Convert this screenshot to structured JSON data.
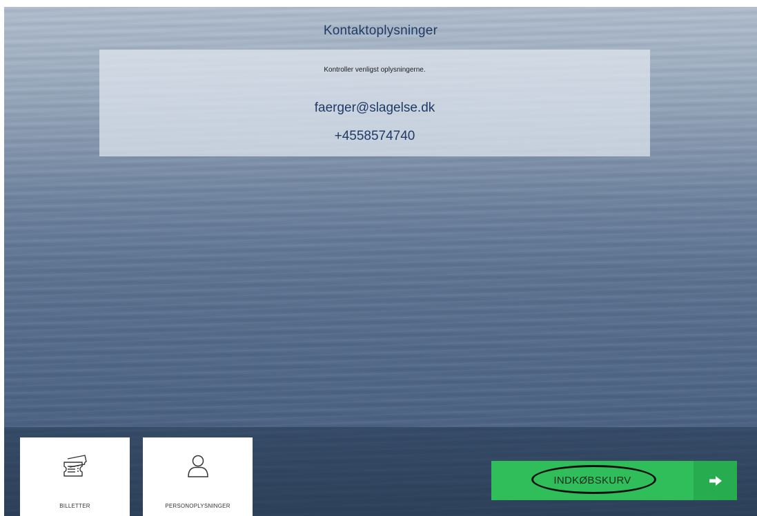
{
  "page": {
    "title": "Kontaktoplysninger"
  },
  "contact": {
    "note": "Kontroller venligst oplysningerne.",
    "email": "faerger@slagelse.dk",
    "phone": "+4558574740"
  },
  "nav": {
    "tiles": [
      {
        "label": "BILLETTER",
        "icon": "ticket-icon"
      },
      {
        "label": "PERSONOPLYSNINGER",
        "icon": "person-icon"
      }
    ]
  },
  "cart_button": {
    "label": "INDKØBSKURV",
    "icon": "arrow-right-icon"
  },
  "colors": {
    "accent_green": "#2fbe5a",
    "title_blue": "#1f3a66"
  }
}
